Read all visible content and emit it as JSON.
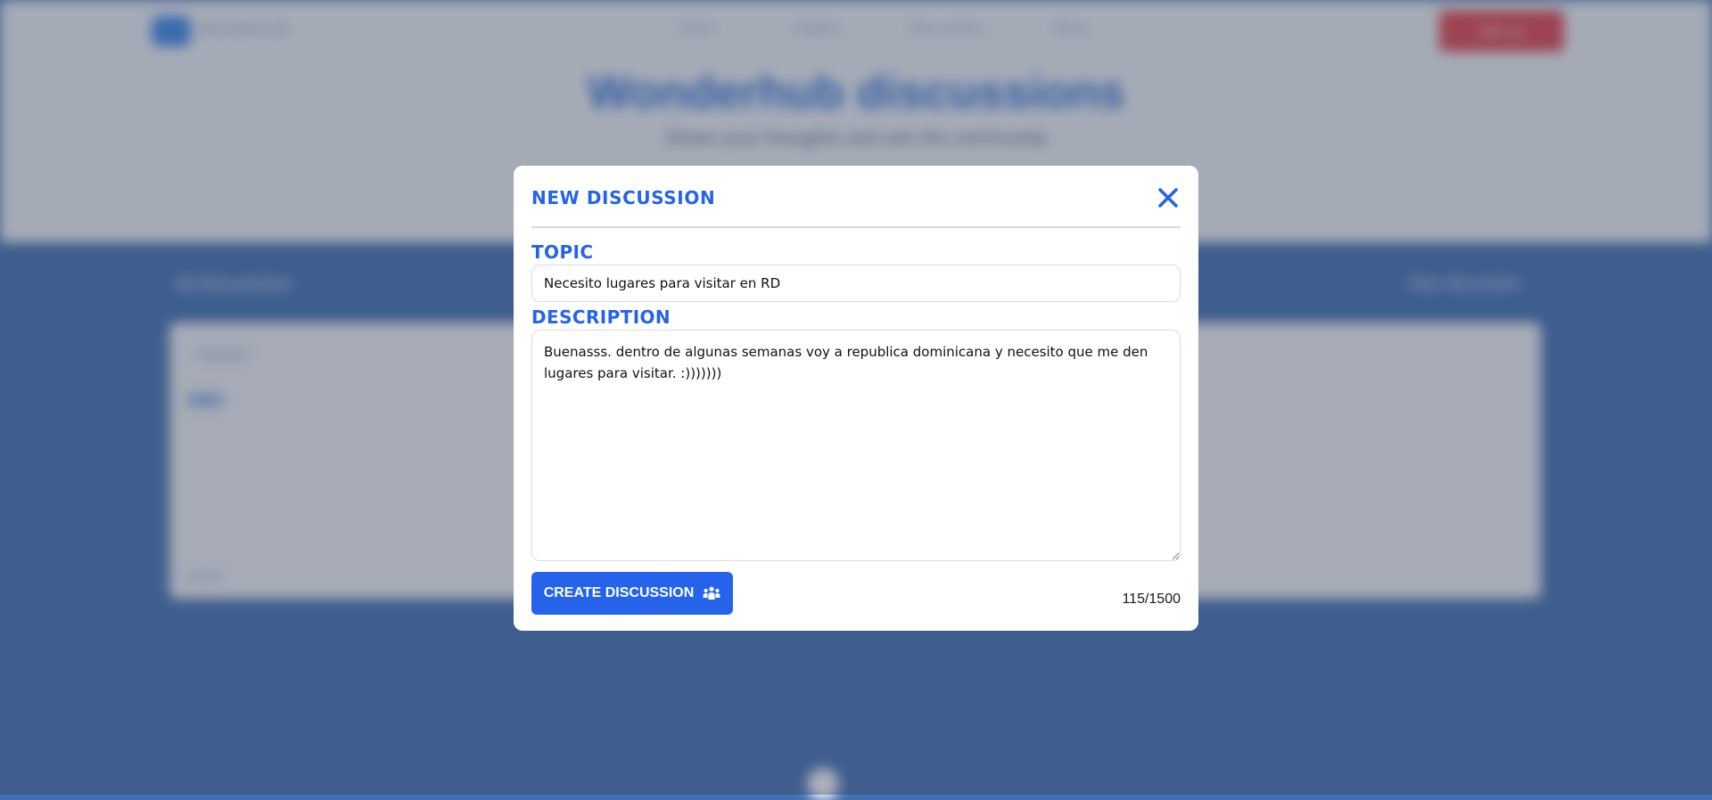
{
  "background_page": {
    "logo_text": "Wonderhub",
    "nav_items": [
      "Home",
      "Explore",
      "Discussions",
      "About"
    ],
    "cta_label": "Sign up",
    "hero_title": "Wonderhub discussions",
    "hero_subtitle": "Share your thoughts and ask the community",
    "bar_left": "All discussions",
    "bar_right": "New discussion"
  },
  "modal": {
    "title": "NEW DISCUSSION",
    "close_icon": "close-icon",
    "topic_label": "TOPIC",
    "topic_value": "Necesito lugares para visitar en RD",
    "description_label": "DESCRIPTION",
    "description_value": "Buenasss. dentro de algunas semanas voy a republica dominicana y necesito que me den lugares para visitar. :)))))))",
    "create_button_label": "CREATE DISCUSSION",
    "create_button_icon": "users-icon",
    "char_count": "115/1500"
  },
  "colors": {
    "accent": "#2563eb",
    "page_blue": "#4270b4",
    "cta_red": "#e3424a"
  }
}
